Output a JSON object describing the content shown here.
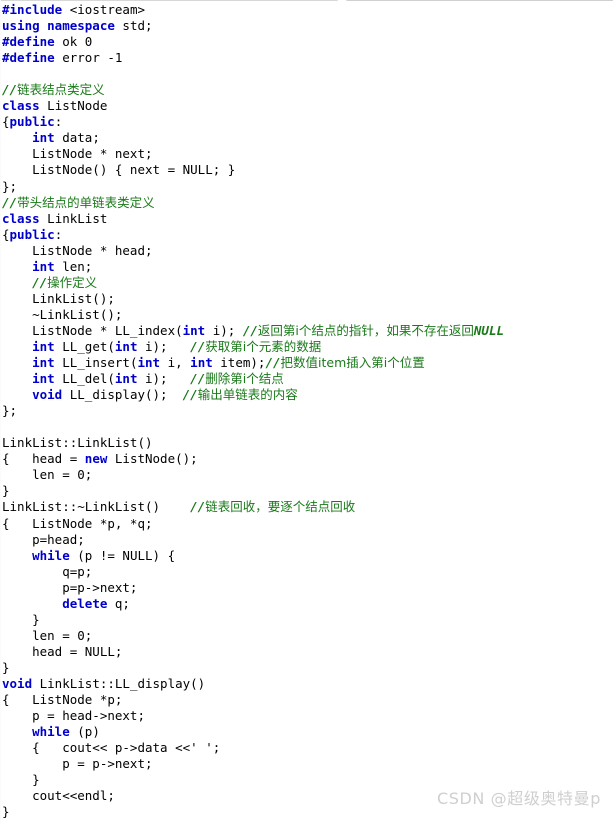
{
  "document": {
    "kind": "code-snippet-screenshot",
    "language": "C++",
    "background_color": "#ffffff",
    "syntax_colors": {
      "keyword": "#0000cc",
      "preprocessor": "#0000cc",
      "comment": "#1a7a1a",
      "plain": "#000000",
      "watermark": "#cfcfcf"
    }
  },
  "watermark": {
    "text": "CSDN @超级奥特曼p"
  },
  "code": {
    "lines": [
      "#include <iostream>",
      "using namespace std;",
      "#define ok 0",
      "#define error -1",
      "",
      "//链表结点类定义",
      "class ListNode",
      "{public:",
      "    int data;",
      "    ListNode * next;",
      "    ListNode() { next = NULL; }",
      "};",
      "//带头结点的单链表类定义",
      "class LinkList",
      "{public:",
      "    ListNode * head;",
      "    int len;",
      "    //操作定义",
      "    LinkList();",
      "    ~LinkList();",
      "    ListNode * LL_index(int i); //返回第i个结点的指针，如果不存在返回NULL",
      "    int LL_get(int i);   //获取第i个元素的数据",
      "    int LL_insert(int i, int item);//把数值item插入第i个位置",
      "    int LL_del(int i);   //删除第i个结点",
      "    void LL_display();  //输出单链表的内容",
      "};",
      "",
      "LinkList::LinkList()",
      "{   head = new ListNode();",
      "    len = 0;",
      "}",
      "LinkList::~LinkList()    //链表回收，要逐个结点回收",
      "{   ListNode *p, *q;",
      "    p=head;",
      "    while (p != NULL) {",
      "        q=p;",
      "        p=p->next;",
      "        delete q;",
      "    }",
      "    len = 0;",
      "    head = NULL;",
      "}",
      "void LinkList::LL_display()",
      "{   ListNode *p;",
      "    p = head->next;",
      "    while (p)",
      "    {   cout<< p->data <<' ';",
      "        p = p->next;",
      "    }",
      "    cout<<endl;",
      "}"
    ]
  },
  "tokens": {
    "keywords": [
      "using",
      "namespace",
      "class",
      "public",
      "int",
      "void",
      "new",
      "delete",
      "while"
    ],
    "preprocessor": [
      "#include",
      "#define"
    ],
    "comments": [
      "//链表结点类定义",
      "//带头结点的单链表类定义",
      "//操作定义",
      "//返回第i个结点的指针，如果不存在返回NULL",
      "//获取第i个元素的数据",
      "//把数值item插入第i个位置",
      "//删除第i个结点",
      "//输出单链表的内容",
      "//链表回收，要逐个结点回收"
    ]
  }
}
